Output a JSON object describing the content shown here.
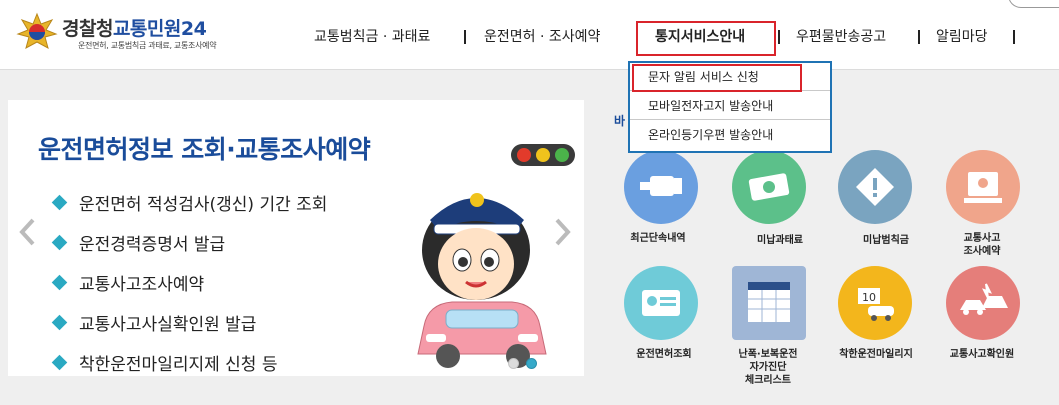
{
  "header": {
    "logo_main": "경찰청",
    "logo_accent": "교통민원24",
    "logo_sub": "운전면허, 교통범칙금 과태료, 교통조사예약"
  },
  "nav": {
    "items": [
      {
        "label": "교통범칙금 · 과태료"
      },
      {
        "label": "운전면허 · 조사예약"
      },
      {
        "label": "통지서비스안내"
      },
      {
        "label": "우편물반송공고"
      },
      {
        "label": "알림마당"
      }
    ],
    "active_index": 2
  },
  "dropdown": {
    "items": [
      {
        "label": "문자 알림 서비스 신청"
      },
      {
        "label": "모바일전자고지 발송안내"
      },
      {
        "label": "온라인등기우편 발송안내"
      }
    ],
    "highlighted_index": 0
  },
  "banner": {
    "title": "운전면허정보 조회·교통조사예약",
    "items": [
      "운전면허 적성검사(갱신) 기간 조회",
      "운전경력증명서 발급",
      "교통사고조사예약",
      "교통사고사실확인원 발급",
      "착한운전마일리지제 신청 등"
    ],
    "slide_count": 2,
    "active_slide": 2
  },
  "quick_menu": {
    "title": "바",
    "items": [
      {
        "label": "최근단속내역",
        "icon": "camera-icon",
        "color": "#6a9fe0"
      },
      {
        "label": "미납과태료",
        "icon": "money-icon",
        "color": "#5cc08a"
      },
      {
        "label": "미납범칙금",
        "icon": "warning-icon",
        "color": "#7aa4c0"
      },
      {
        "label": "교통사고\n조사예약",
        "icon": "computer-icon",
        "color": "#f0a58b"
      },
      {
        "label": "운전면허조회",
        "icon": "id-card-icon",
        "color": "#6fcbd8"
      },
      {
        "label": "난폭·보복운전\n자가진단\n체크리스트",
        "icon": "calendar-icon",
        "color": "#9fb6d6"
      },
      {
        "label": "착한운전마일리지",
        "icon": "mileage-icon",
        "color": "#f3b61c"
      },
      {
        "label": "교통사고확인원",
        "icon": "accident-icon",
        "color": "#e57e7a"
      }
    ]
  },
  "colors": {
    "brand_blue": "#1a4c9a",
    "highlight_red": "#d9242b",
    "dropdown_border": "#1f73b4",
    "bullet": "#2aa9c2"
  }
}
